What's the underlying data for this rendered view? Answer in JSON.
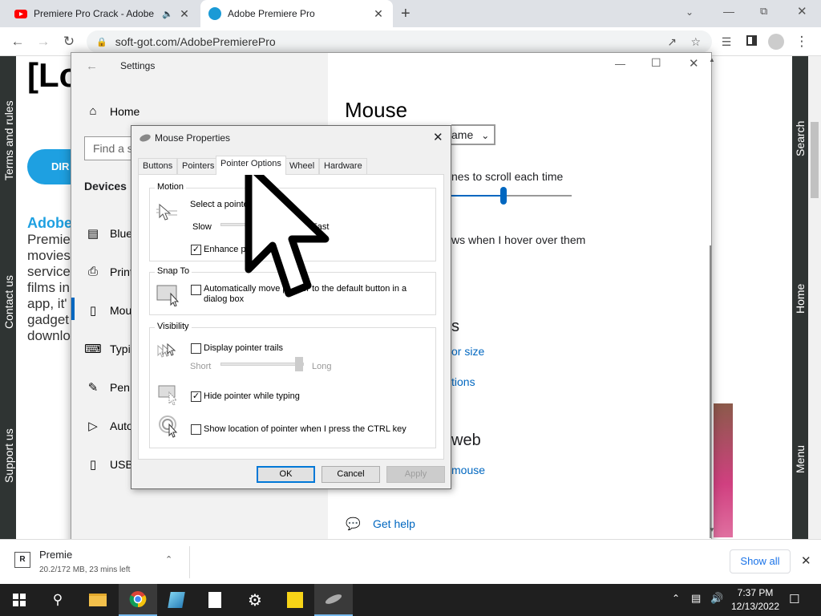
{
  "browser": {
    "tabs": [
      {
        "title": "Premiere Pro Crack - Adobe",
        "icon": "youtube-icon"
      },
      {
        "title": "Adobe Premiere Pro",
        "icon": "site-favicon"
      }
    ],
    "url": "soft-got.com/AdobePremierePro",
    "new_tab": "+"
  },
  "site": {
    "logo_text": "[Lo",
    "button_text": "DIR",
    "heading": "Adobe",
    "paragraph_lines": [
      "Premie",
      "movies",
      "service",
      "films in",
      "app, it'",
      "gadget",
      "downlo"
    ],
    "left_nav": [
      "Terms and rules",
      "Contact us",
      "Support us"
    ],
    "right_nav": [
      "Search",
      "Home",
      "Menu"
    ]
  },
  "settings": {
    "title": "Settings",
    "home": "Home",
    "search_placeholder": "Find a s",
    "section": "Devices",
    "items": [
      "Bluet",
      "Print",
      "Mou",
      "Typin",
      "Pen &",
      "Auto",
      "USB"
    ],
    "page_title": "Mouse",
    "dropdown_value": "ame",
    "scroll_label": "nes to scroll each time",
    "hover_label": "ws when I hover over them",
    "heading_partial": "s",
    "link_size": "or size",
    "link_options": "tions",
    "heading_web": "web",
    "link_mouse": "mouse",
    "get_help": "Get help"
  },
  "mouse_properties": {
    "title": "Mouse Properties",
    "tabs": [
      "Buttons",
      "Pointers",
      "Pointer Options",
      "Wheel",
      "Hardware"
    ],
    "motion": {
      "label": "Motion",
      "select_text": "Select a pointer",
      "slow": "Slow",
      "fast": "Fast",
      "enhance": "Enhance po",
      "enhance_checked": true
    },
    "snap": {
      "label": "Snap To",
      "text_line1": "Automatically move pointer to the default button in a",
      "text_line2": "dialog box",
      "checked": false
    },
    "visibility": {
      "label": "Visibility",
      "trails": "Display pointer trails",
      "trails_checked": false,
      "short": "Short",
      "long": "Long",
      "hide": "Hide pointer while typing",
      "hide_checked": true,
      "ctrl": "Show location of pointer when I press the CTRL key",
      "ctrl_checked": false
    },
    "buttons": {
      "ok": "OK",
      "cancel": "Cancel",
      "apply": "Apply"
    }
  },
  "downloads": {
    "filename": "Premie",
    "status": "20.2/172 MB, 23 mins left",
    "show_all": "Show all"
  },
  "taskbar": {
    "time": "7:37 PM",
    "date": "12/13/2022"
  }
}
